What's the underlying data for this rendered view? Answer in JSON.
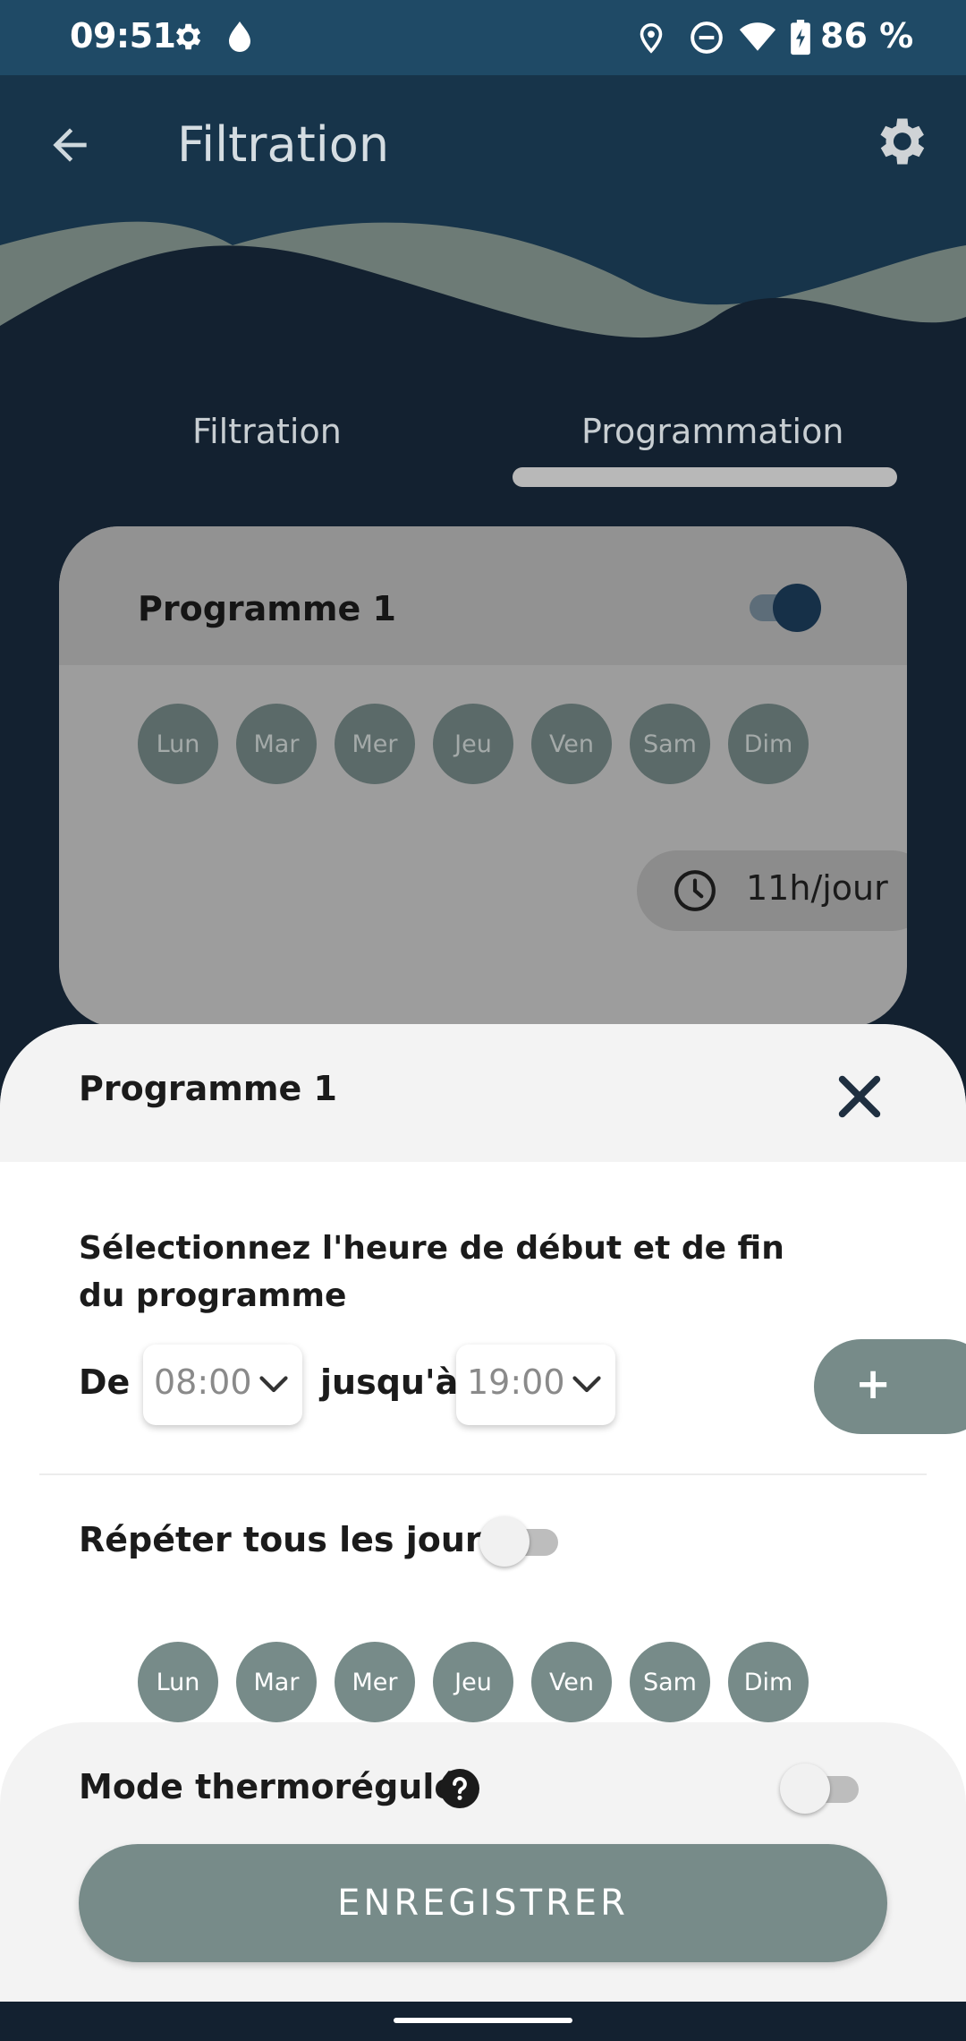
{
  "status_bar": {
    "time": "09:51",
    "battery": "86 %",
    "icons": [
      "settings-icon",
      "drop-icon",
      "location-icon",
      "do-not-disturb-icon",
      "wifi-icon",
      "battery-charging-icon"
    ]
  },
  "header": {
    "title": "Filtration",
    "back_icon": "arrow-back-icon",
    "settings_icon": "gear-icon"
  },
  "tabs": [
    {
      "label": "Filtration",
      "active": false
    },
    {
      "label": "Programmation",
      "active": true
    }
  ],
  "program_card": {
    "title": "Programme 1",
    "enabled": true,
    "days": [
      "Lun",
      "Mar",
      "Mer",
      "Jeu",
      "Ven",
      "Sam",
      "Dim"
    ],
    "duration": "11h/jour"
  },
  "sheet": {
    "title": "Programme 1",
    "instruction": "Sélectionnez l'heure de début et de fin du programme",
    "from_label": "De",
    "start_time": "08:00",
    "until_label": "jusqu'à",
    "end_time": "19:00",
    "add_label": "+",
    "repeat_label": "Répéter tous les jours",
    "repeat_enabled": false,
    "days": [
      "Lun",
      "Mar",
      "Mer",
      "Jeu",
      "Ven",
      "Sam",
      "Dim"
    ],
    "thermo_label": "Mode thermorégulé",
    "thermo_enabled": false,
    "save_label": "ENREGISTRER"
  },
  "colors": {
    "accent": "#778b89",
    "header_dark": "#17344a",
    "status_bar": "#1f4a66"
  }
}
